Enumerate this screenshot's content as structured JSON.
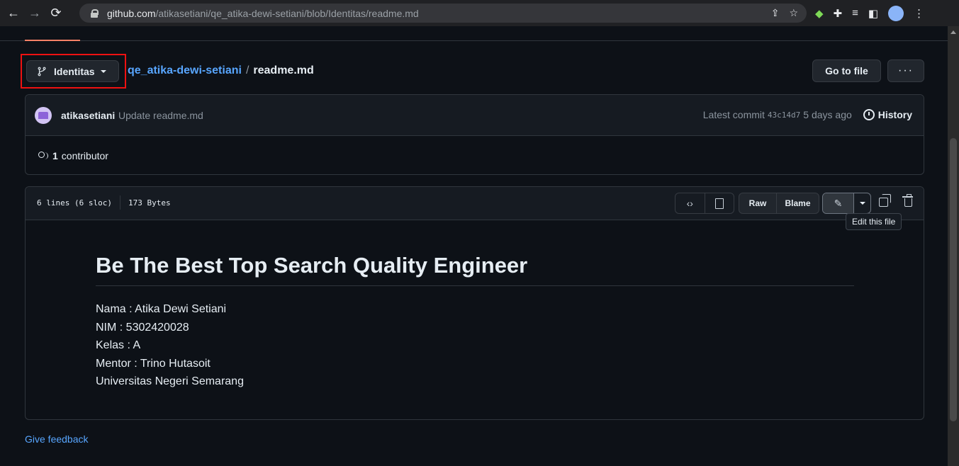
{
  "browser": {
    "url_host": "github.com",
    "url_path": "/atikasetiani/qe_atika-dewi-setiani/blob/Identitas/readme.md"
  },
  "header": {
    "branch_label": "Identitas",
    "repo_name": "qe_atika-dewi-setiani",
    "path_separator": "/",
    "file_name": "readme.md",
    "go_to_file_label": "Go to file",
    "more_label": "···"
  },
  "commit": {
    "author": "atikasetiani",
    "message": "Update readme.md",
    "latest_label": "Latest commit",
    "sha": "43c14d7",
    "age": "5 days ago",
    "history_label": "History",
    "contributor_count": "1",
    "contributor_label": "contributor"
  },
  "file": {
    "lines_info": "6 lines (6 sloc)",
    "size": "173 Bytes",
    "raw_label": "Raw",
    "blame_label": "Blame",
    "tooltip": "Edit this file"
  },
  "readme": {
    "title": "Be The Best Top Search Quality Engineer",
    "lines": [
      "Nama : Atika Dewi Setiani",
      "NIM : 5302420028",
      "Kelas : A",
      "Mentor : Trino Hutasoit",
      "Universitas Negeri Semarang"
    ]
  },
  "footer": {
    "feedback_label": "Give feedback"
  },
  "colors": {
    "background": "#0d1117",
    "link": "#58a6ff",
    "highlight": "#ee1111"
  }
}
